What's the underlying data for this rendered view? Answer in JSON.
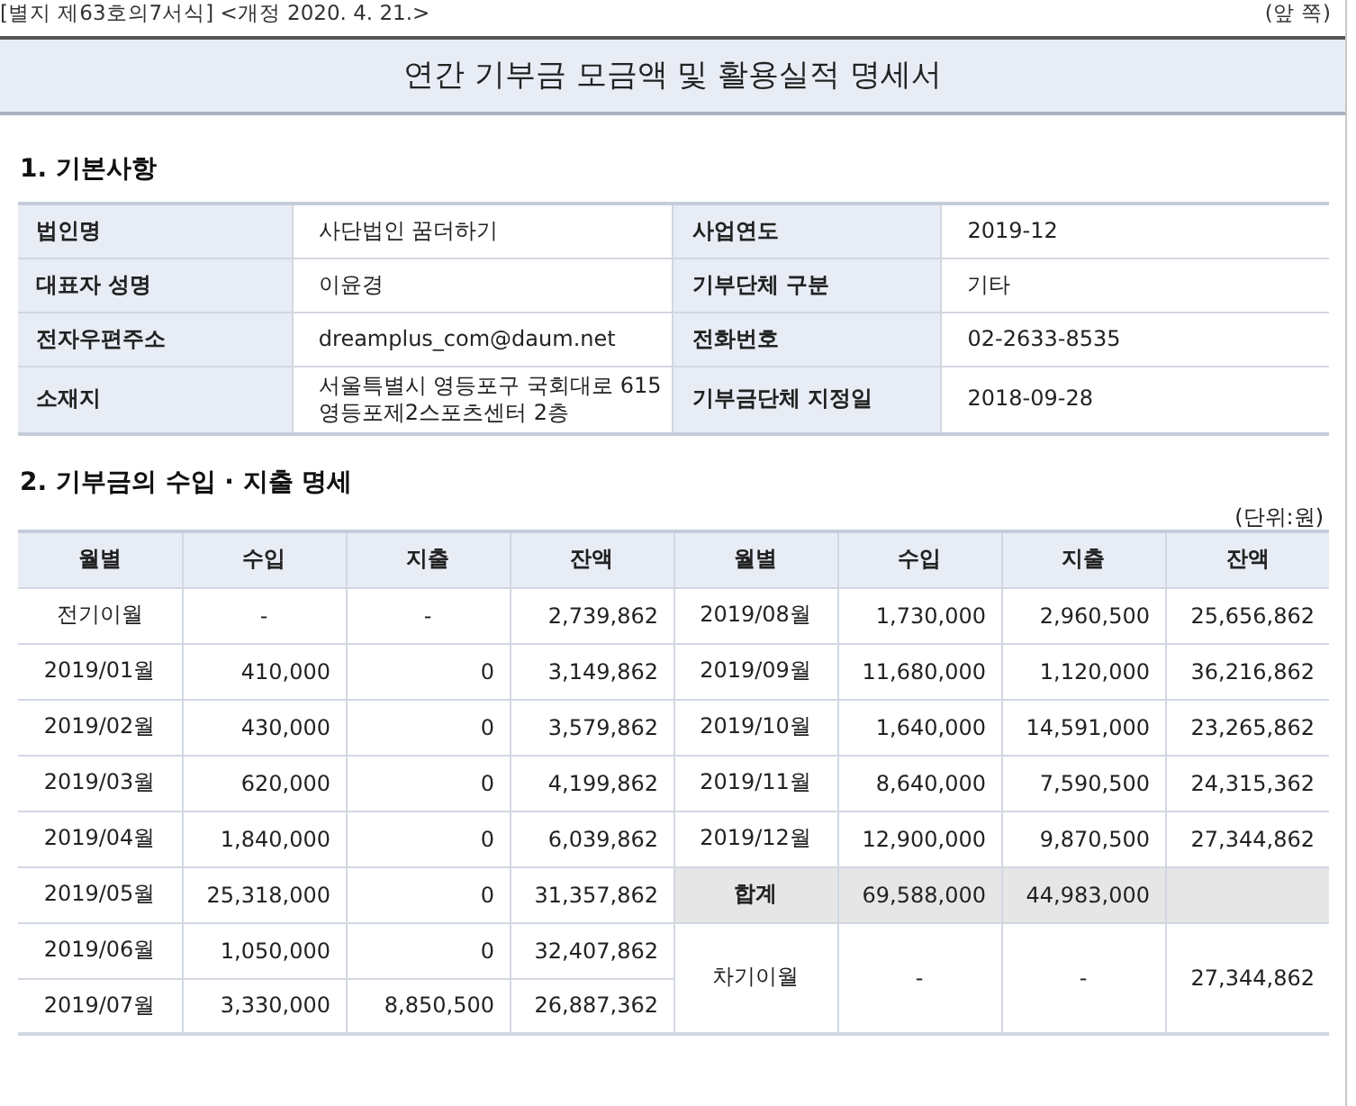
{
  "form_note": "[별지 제63호의7서식] <개정 2020. 4. 21.>",
  "page_side": "(앞 쪽)",
  "title": "연간 기부금 모금액 및 활용실적 명세서",
  "section_1": {
    "heading": "1. 기본사항",
    "rows": [
      [
        {
          "label": "법인명",
          "value": "사단법인 꿈더하기"
        },
        {
          "label": "사업연도",
          "value": "2019-12"
        }
      ],
      [
        {
          "label": "대표자 성명",
          "value": "이윤경"
        },
        {
          "label": "기부단체 구분",
          "value": "기타"
        }
      ],
      [
        {
          "label": "전자우편주소",
          "value": "dreamplus_com@daum.net"
        },
        {
          "label": "전화번호",
          "value": "02-2633-8535"
        }
      ],
      [
        {
          "label": "소재지",
          "value": "서울특별시 영등포구 국회대로 615\n영등포제2스포츠센터 2층"
        },
        {
          "label": "기부금단체 지정일",
          "value": "2018-09-28"
        }
      ]
    ]
  },
  "section_2": {
    "heading": "2. 기부금의 수입 · 지출 명세",
    "unit": "(단위:원)",
    "columns": [
      "월별",
      "수입",
      "지출",
      "잔액",
      "월별",
      "수입",
      "지출",
      "잔액"
    ],
    "left_rows": [
      {
        "month": "전기이월",
        "income": "-",
        "expense": "-",
        "balance": "2,739,862"
      },
      {
        "month": "2019/01월",
        "income": "410,000",
        "expense": "0",
        "balance": "3,149,862"
      },
      {
        "month": "2019/02월",
        "income": "430,000",
        "expense": "0",
        "balance": "3,579,862"
      },
      {
        "month": "2019/03월",
        "income": "620,000",
        "expense": "0",
        "balance": "4,199,862"
      },
      {
        "month": "2019/04월",
        "income": "1,840,000",
        "expense": "0",
        "balance": "6,039,862"
      },
      {
        "month": "2019/05월",
        "income": "25,318,000",
        "expense": "0",
        "balance": "31,357,862"
      },
      {
        "month": "2019/06월",
        "income": "1,050,000",
        "expense": "0",
        "balance": "32,407,862"
      },
      {
        "month": "2019/07월",
        "income": "3,330,000",
        "expense": "8,850,500",
        "balance": "26,887,362"
      }
    ],
    "right_rows": [
      {
        "kind": "month",
        "month": "2019/08월",
        "income": "1,730,000",
        "expense": "2,960,500",
        "balance": "25,656,862"
      },
      {
        "kind": "month",
        "month": "2019/09월",
        "income": "11,680,000",
        "expense": "1,120,000",
        "balance": "36,216,862"
      },
      {
        "kind": "month",
        "month": "2019/10월",
        "income": "1,640,000",
        "expense": "14,591,000",
        "balance": "23,265,862"
      },
      {
        "kind": "month",
        "month": "2019/11월",
        "income": "8,640,000",
        "expense": "7,590,500",
        "balance": "24,315,362"
      },
      {
        "kind": "month",
        "month": "2019/12월",
        "income": "12,900,000",
        "expense": "9,870,500",
        "balance": "27,344,862"
      },
      {
        "kind": "total",
        "month": "합계",
        "income": "69,588,000",
        "expense": "44,983,000"
      },
      {
        "kind": "carryover",
        "month": "차기이월",
        "income": "-",
        "expense": "-",
        "balance": "27,344,862"
      }
    ]
  }
}
